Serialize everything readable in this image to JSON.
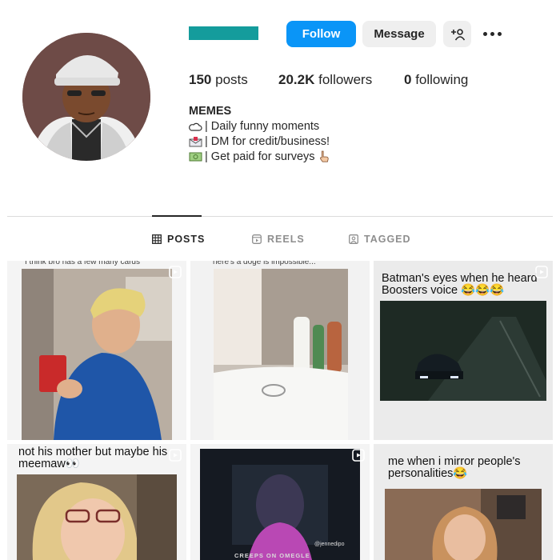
{
  "profile": {
    "follow_label": "Follow",
    "message_label": "Message",
    "stats": {
      "posts_count": "150",
      "posts_label": "posts",
      "followers_count": "20.2K",
      "followers_label": "followers",
      "following_count": "0",
      "following_label": "following"
    },
    "bio": {
      "name": "MEMES",
      "lines": [
        "| Daily funny moments",
        "| DM for credit/business!",
        "| Get paid for surveys"
      ]
    }
  },
  "tabs": [
    {
      "label": "POSTS",
      "active": true
    },
    {
      "label": "REELS",
      "active": false
    },
    {
      "label": "TAGGED",
      "active": false
    }
  ],
  "posts": [
    {
      "caption": "I think bro has a few many cards"
    },
    {
      "caption": "here's a doge is impossible..."
    },
    {
      "caption": "Batman's eyes when he heard Boosters voice 😂😂😂"
    },
    {
      "caption": "not his mother but maybe his meemaw👀"
    },
    {
      "caption": "",
      "watermark": "@jennedipo",
      "overlay": "CREEPS ON OMEGLE"
    },
    {
      "caption": "me when i mirror people's personalities😂"
    }
  ],
  "colors": {
    "accent": "#0a95f7",
    "username_redaction": "#149c9c"
  }
}
